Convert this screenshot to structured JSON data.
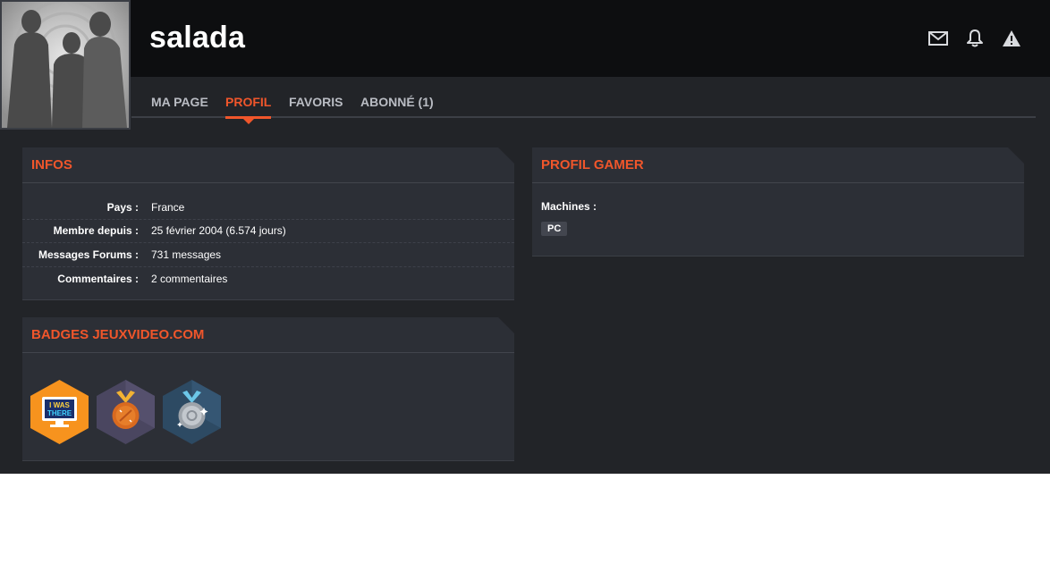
{
  "profile": {
    "username": "salada",
    "avatar_icon": "silhouette-avatar"
  },
  "header_icons": [
    "mail-icon",
    "bell-icon",
    "warning-icon"
  ],
  "tabs": [
    {
      "label": "MA PAGE",
      "active": false
    },
    {
      "label": "PROFIL",
      "active": true
    },
    {
      "label": "FAVORIS",
      "active": false
    },
    {
      "label": "ABONNÉ (1)",
      "active": false
    }
  ],
  "infos": {
    "title": "INFOS",
    "rows": [
      {
        "label": "Pays :",
        "value": "France"
      },
      {
        "label": "Membre depuis :",
        "value": "25 février 2004 (6.574 jours)"
      },
      {
        "label": "Messages Forums :",
        "value": "731 messages"
      },
      {
        "label": "Commentaires :",
        "value": "2 commentaires"
      }
    ]
  },
  "badges": {
    "title": "BADGES JEUXVIDEO.COM",
    "items": [
      {
        "icon": "i-was-there-badge-icon",
        "text_line1": "I WAS",
        "text_line2": "THERE"
      },
      {
        "icon": "bronze-medal-badge-icon"
      },
      {
        "icon": "silver-medal-badge-icon"
      }
    ]
  },
  "gamer": {
    "title": "PROFIL GAMER",
    "machines_label": "Machines :",
    "machines": [
      "PC"
    ]
  },
  "colors": {
    "accent": "#f0562b",
    "background": "#222428",
    "panel": "#2c2f36",
    "header": "#0d0e10"
  }
}
